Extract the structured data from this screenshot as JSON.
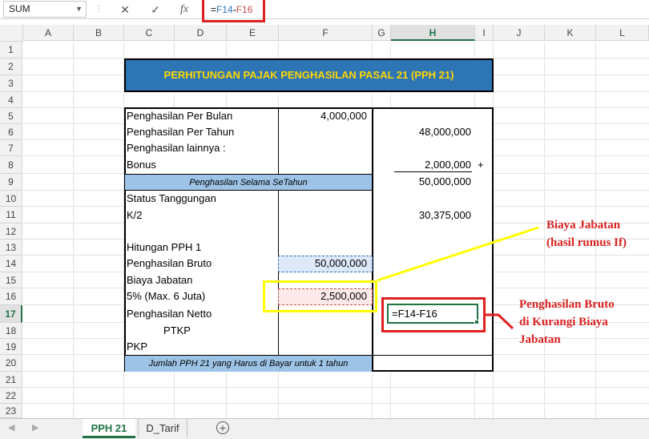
{
  "namebox": "SUM",
  "formula": {
    "eq": "=",
    "ref1": "F14",
    "op": "-",
    "ref2": "F16"
  },
  "columns": [
    "A",
    "B",
    "C",
    "D",
    "E",
    "F",
    "G",
    "H",
    "I",
    "J",
    "K",
    "L"
  ],
  "rows": [
    "1",
    "2",
    "3",
    "4",
    "5",
    "6",
    "7",
    "8",
    "9",
    "10",
    "11",
    "12",
    "13",
    "14",
    "15",
    "16",
    "17",
    "18",
    "19",
    "20",
    "21",
    "22",
    "23"
  ],
  "table": {
    "title": "PERHITUNGAN PAJAK PENGHASILAN PASAL 21 (PPH 21)",
    "r5_label": "Penghasilan Per Bulan",
    "r5_f": "4,000,000",
    "r6_label": "Penghasilan Per Tahun",
    "r6_h": "48,000,000",
    "r7_label": "Penghasilan lainnya :",
    "r8_label": "Bonus",
    "r8_h": "2,000,000",
    "r8_plus": "+",
    "r9_label": "Penghasilan Selama SeTahun",
    "r9_h": "50,000,000",
    "r10_label": "Status Tanggungan",
    "r11_label": "K/2",
    "r11_h": "30,375,000",
    "r13_label": "Hitungan PPH 1",
    "r14_label": "Penghasilan Bruto",
    "r14_f": "50,000,000",
    "r15_label": "Biaya Jabatan",
    "r16_label": "5% (Max. 6 Juta)",
    "r16_f": "2,500,000",
    "r17_label": "Penghasilan Netto",
    "r17_h": "=F14-F16",
    "r18_label": "PTKP",
    "r19_label": "PKP",
    "r20_label": "Jumlah PPH 21 yang Harus di Bayar untuk 1 tahun"
  },
  "annotations": {
    "biaya_line1": "Biaya Jabatan",
    "biaya_line2": "(hasil rumus If)",
    "bruto_line1": "Penghasilan Bruto",
    "bruto_line2": "di Kurangi Biaya",
    "bruto_line3": "Jabatan"
  },
  "tabs": [
    "PPH 21",
    "D_Tarif"
  ],
  "colors": {
    "title_bg": "#2e75b6",
    "title_text": "#ffd700",
    "band_bg": "#9dc3e6",
    "accent": "#217346",
    "annot_red": "#d92020",
    "annot_yellow": "#ffff00"
  },
  "icons": [
    "cancel-icon",
    "enter-icon",
    "function-icon",
    "add-sheet-icon"
  ]
}
